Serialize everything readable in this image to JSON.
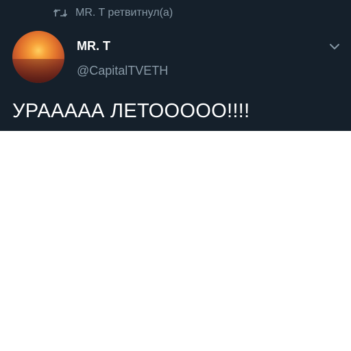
{
  "retweet": {
    "icon": "retweet-icon",
    "text": "MR. T ретвитнул(а)"
  },
  "author": {
    "name": "MR. T",
    "handle": "@CapitalTVETH",
    "avatar": "sunset-avatar"
  },
  "tweet": {
    "text": "УРААААА ЛЕТООООО!!!!"
  },
  "actions": {
    "more_icon": "chevron-down-icon"
  },
  "colors": {
    "card_background": "#15202b",
    "secondary_text": "#8899a6",
    "primary_text": "#ffffff"
  }
}
